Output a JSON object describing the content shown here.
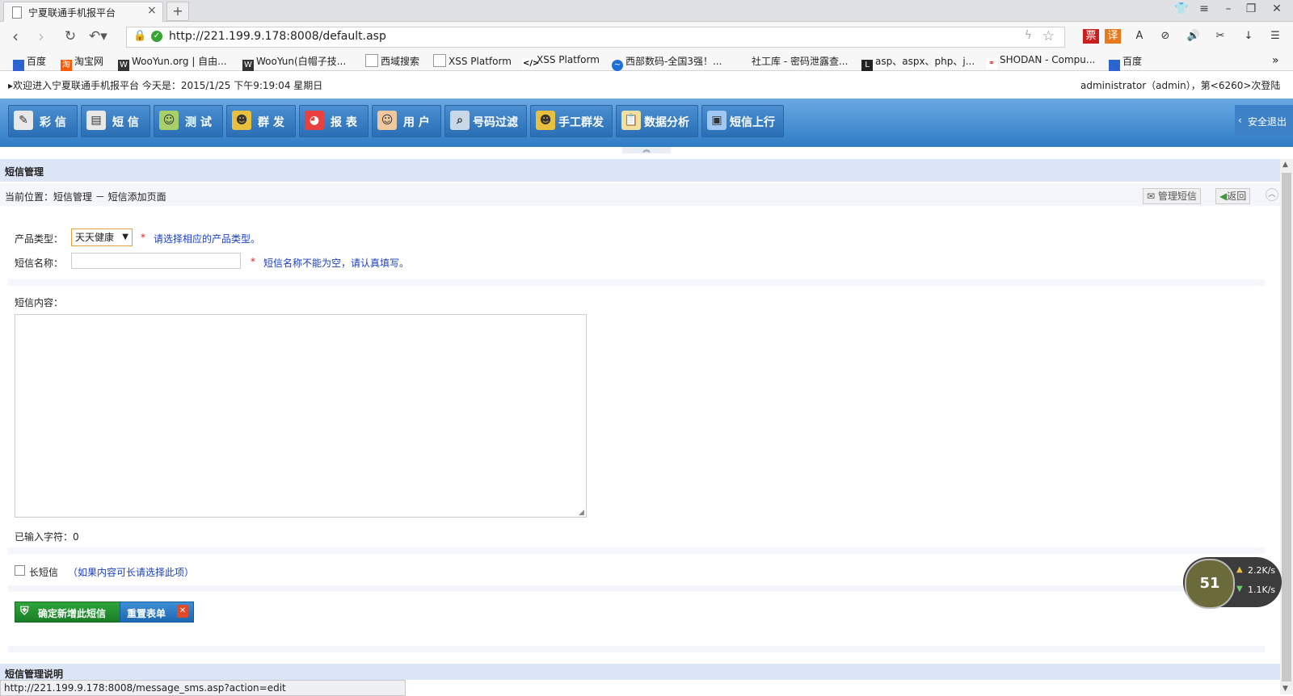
{
  "browser": {
    "tab_title": "宁夏联通手机报平台",
    "tab_close": "×",
    "new_tab": "+",
    "url": "http://221.199.9.178:8008/default.asp",
    "status_url": "http://221.199.9.178:8008/message_sms.asp?action=edit",
    "bookmarks": [
      "百度",
      "淘宝网",
      "WooYun.org | 自由...",
      "WooYun(白帽子技...",
      "西域搜索",
      "XSS Platform",
      "XSS Platform",
      "西部数码-全国3强！...",
      "社工库 - 密码泄露查...",
      "asp、aspx、php、j...",
      "SHODAN - Compu...",
      "百度"
    ],
    "icons": [
      "back-icon",
      "forward-icon",
      "reload-icon",
      "undo-icon",
      "lock-icon",
      "shield-icon",
      "lightning-icon",
      "star-icon"
    ],
    "extensions": [
      "票",
      "译",
      "A",
      "⊘",
      "🔊",
      "✂",
      "↓",
      "☰"
    ]
  },
  "header": {
    "welcome": "欢迎进入宁夏联通手机报平台 今天是：2015/1/25 下午9:19:04 星期日",
    "user_info": "administrator（admin），第<6260>次登陆"
  },
  "menu": {
    "items": [
      {
        "label": "彩 信",
        "color": "#e8e8e8",
        "icon": "edit-icon"
      },
      {
        "label": "短 信",
        "color": "#e8e8e8",
        "icon": "document-icon"
      },
      {
        "label": "测 试",
        "color": "#a8d06a",
        "icon": "chat-icon"
      },
      {
        "label": "群 发",
        "color": "#e8c040",
        "icon": "group-icon"
      },
      {
        "label": "报 表",
        "color": "#e84040",
        "icon": "pie-chart-icon"
      },
      {
        "label": "用 户",
        "color": "#f0c8a0",
        "icon": "user-icon"
      },
      {
        "label": "号码过滤",
        "color": "#c8d8e8",
        "icon": "filter-icon"
      },
      {
        "label": "手工群发",
        "color": "#e8c040",
        "icon": "group-send-icon"
      },
      {
        "label": "数据分析",
        "color": "#f0e0a0",
        "icon": "clipboard-icon"
      },
      {
        "label": "短信上行",
        "color": "#a0c8f0",
        "icon": "screen-icon"
      }
    ],
    "logout": "安全退出"
  },
  "page": {
    "section_title": "短信管理",
    "breadcrumb": "当前位置：短信管理 － 短信添加页面",
    "manage_button": "管理短信",
    "back_button": "返回"
  },
  "form": {
    "product_type_label": "产品类型：",
    "product_type_value": "天天健康",
    "product_type_hint": "请选择相应的产品类型。",
    "sms_name_label": "短信名称：",
    "sms_name_value": "",
    "sms_name_hint": "短信名称不能为空，请认真填写。",
    "required_mark": "*",
    "content_label": "短信内容：",
    "content_value": "",
    "char_count": "已输入字符：0",
    "long_sms_label": "长短信",
    "long_sms_hint": "（如果内容可长请选择此项）",
    "submit": "确定新增此短信",
    "reset": "重置表单"
  },
  "footer": {
    "section_title": "短信管理说明"
  },
  "speed_widget": {
    "logo": "51",
    "up": "2.2K/s",
    "down": "1.1K/s"
  }
}
